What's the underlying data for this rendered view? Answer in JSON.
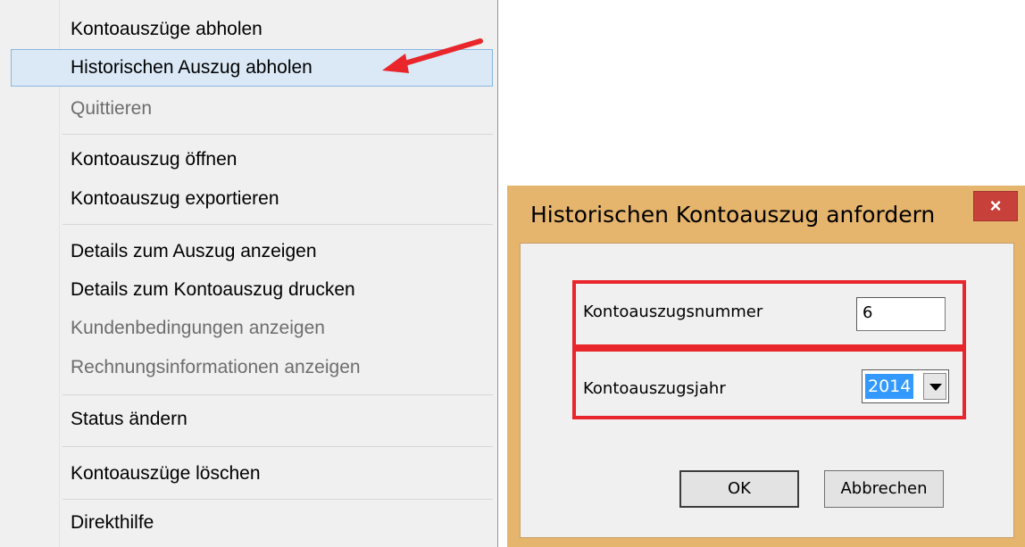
{
  "context_menu": {
    "items": [
      {
        "label": "Kontoauszüge abholen",
        "state": "normal"
      },
      {
        "label": "Historischen Auszug abholen",
        "state": "highlighted"
      },
      {
        "label": "Quittieren",
        "state": "disabled"
      },
      {
        "label": "Kontoauszug öffnen",
        "state": "normal"
      },
      {
        "label": "Kontoauszug exportieren",
        "state": "normal"
      },
      {
        "label": "Details zum Auszug anzeigen",
        "state": "normal"
      },
      {
        "label": "Details zum Kontoauszug drucken",
        "state": "normal"
      },
      {
        "label": "Kundenbedingungen anzeigen",
        "state": "disabled"
      },
      {
        "label": "Rechnungsinformationen anzeigen",
        "state": "disabled"
      },
      {
        "label": "Status ändern",
        "state": "normal"
      },
      {
        "label": "Kontoauszüge löschen",
        "state": "normal"
      },
      {
        "label": "Direkthilfe",
        "state": "normal"
      }
    ]
  },
  "dialog": {
    "title": "Historischen Kontoauszug anfordern",
    "close_glyph": "×",
    "statement_number_label": "Kontoauszugsnummer",
    "statement_number_value": "6",
    "statement_year_label": "Kontoauszugsjahr",
    "statement_year_value": "2014",
    "ok_label": "OK",
    "cancel_label": "Abbrechen"
  },
  "colors": {
    "menu_bg": "#f0f0f0",
    "highlight_bg": "#dbe9f7",
    "highlight_border": "#8ab5e2",
    "disabled_text": "#6d6d6d",
    "dialog_frame": "#e5b46d",
    "close_button": "#c7403a",
    "annotation_red": "#e8262b",
    "selection_blue": "#3399ff"
  },
  "icons": [
    "red-annotation-arrow",
    "close-icon",
    "dropdown-arrow-icon"
  ]
}
